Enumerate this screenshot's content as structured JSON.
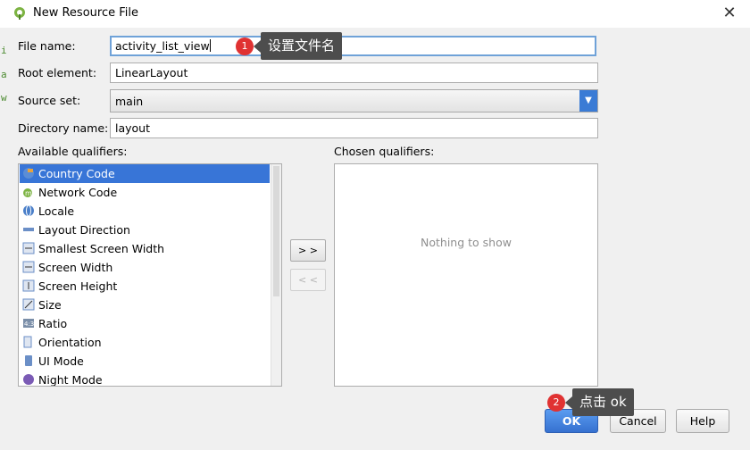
{
  "dialog": {
    "title": "New Resource File",
    "file_name_label": "File name:",
    "file_name_value": "activity_list_view",
    "root_element_label": "Root element:",
    "root_element_value": "LinearLayout",
    "source_set_label": "Source set:",
    "source_set_value": "main",
    "directory_label": "Directory name:",
    "directory_value": "layout",
    "available_label": "Available qualifiers:",
    "chosen_label": "Chosen qualifiers:",
    "empty_text": "Nothing to show",
    "add_label": "> >",
    "remove_label": "< <",
    "ok_label": "OK",
    "cancel_label": "Cancel",
    "help_label": "Help"
  },
  "qualifiers": [
    {
      "label": "Country Code",
      "icon": "globe-flag-icon"
    },
    {
      "label": "Network Code",
      "icon": "network-icon"
    },
    {
      "label": "Locale",
      "icon": "globe-icon"
    },
    {
      "label": "Layout Direction",
      "icon": "layout-direction-icon"
    },
    {
      "label": "Smallest Screen Width",
      "icon": "smallest-width-icon"
    },
    {
      "label": "Screen Width",
      "icon": "screen-width-icon"
    },
    {
      "label": "Screen Height",
      "icon": "screen-height-icon"
    },
    {
      "label": "Size",
      "icon": "size-icon"
    },
    {
      "label": "Ratio",
      "icon": "ratio-icon"
    },
    {
      "label": "Orientation",
      "icon": "orientation-icon"
    },
    {
      "label": "UI Mode",
      "icon": "ui-mode-icon"
    },
    {
      "label": "Night Mode",
      "icon": "night-mode-icon"
    }
  ],
  "annotations": {
    "step1_number": "1",
    "step1_text": "设置文件名",
    "step2_number": "2",
    "step2_text": "点击 ok"
  },
  "colors": {
    "selection": "#3875d7",
    "accent": "#3a7bd5",
    "badge": "#e03232",
    "callout": "#4d4d4d"
  }
}
